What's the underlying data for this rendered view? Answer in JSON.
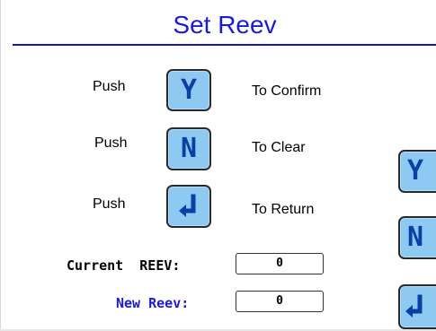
{
  "page": {
    "title": "Set Reev"
  },
  "instructions": [
    {
      "push_label": "Push",
      "key": "Y",
      "action": "To Confirm",
      "icon": "y-key-icon"
    },
    {
      "push_label": "Push",
      "key": "N",
      "action": "To Clear",
      "icon": "n-key-icon"
    },
    {
      "push_label": "Push",
      "key": "enter",
      "action": "To Return",
      "icon": "return-arrow-icon"
    }
  ],
  "fields": {
    "current": {
      "label_a": "Current",
      "label_b": "REEV:",
      "value": "0"
    },
    "new": {
      "label": "New Reev:",
      "value": "0"
    }
  },
  "side_keys": [
    {
      "key": "Y",
      "icon": "y-key-icon"
    },
    {
      "key": "N",
      "icon": "n-key-icon"
    },
    {
      "key": "enter",
      "icon": "return-arrow-icon"
    }
  ],
  "colors": {
    "title": "#1a1adb",
    "rule": "#1515c8",
    "key_fill": "#8ec9f2",
    "key_glyph": "#0a3fa6",
    "new_label": "#1a1adb"
  }
}
